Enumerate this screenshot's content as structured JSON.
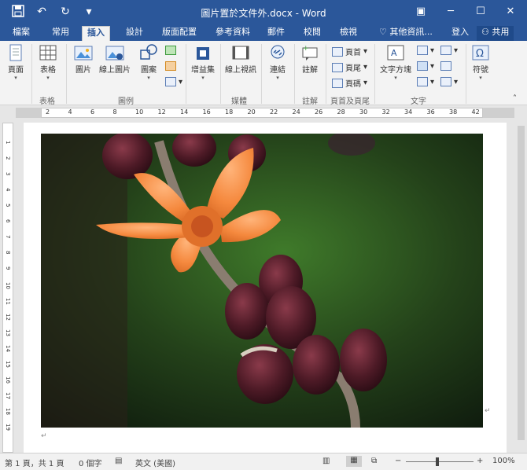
{
  "window": {
    "title": "圖片置於文件外.docx - Word",
    "qat_icons": [
      "save-icon",
      "undo-icon",
      "redo-icon",
      "customize-icon"
    ],
    "controls_icons": [
      "ribbon-display-icon",
      "minimize-icon",
      "maximize-icon",
      "close-icon"
    ]
  },
  "tabs": [
    "檔案",
    "常用",
    "插入",
    "設計",
    "版面配置",
    "參考資料",
    "郵件",
    "校閱",
    "檢視"
  ],
  "active_tab": "插入",
  "tell_me": "其他資訊...",
  "signin": "登入",
  "share": "共用",
  "ribbon": {
    "page_btn": "頁面",
    "table_btn": "表格",
    "picture_btn": "圖片",
    "online_picture_btn": "線上圖片",
    "shapes_btn": "圖案",
    "addins_btn": "增益集",
    "online_video_btn": "線上視訊",
    "links_btn": "連結",
    "comment_btn": "註解",
    "header_btn": "頁首",
    "footer_btn": "頁尾",
    "page_number_btn": "頁碼",
    "textbox_btn": "文字方塊",
    "symbol_btn": "符號",
    "groups": {
      "table": "表格",
      "illustrations": "圖例",
      "media": "媒體",
      "comments": "註解",
      "header_footer": "頁首及頁尾",
      "text": "文字"
    }
  },
  "ruler_ticks": [
    "2",
    "4",
    "6",
    "8",
    "10",
    "12",
    "14",
    "16",
    "18",
    "20",
    "22",
    "24",
    "26",
    "28",
    "30",
    "32",
    "34",
    "36",
    "38",
    "42"
  ],
  "vruler_ticks": [
    "1",
    "2",
    "3",
    "4",
    "5",
    "6",
    "7",
    "8",
    "9",
    "10",
    "11",
    "12",
    "13",
    "14",
    "15",
    "16",
    "17",
    "18",
    "19"
  ],
  "status": {
    "page": "第 1 頁，共 1 頁",
    "words": "0 個字",
    "language": "英文 (美國)",
    "zoom": "100%",
    "zoom_level": 1.0
  },
  "colors": {
    "accent": "#2b579a"
  }
}
